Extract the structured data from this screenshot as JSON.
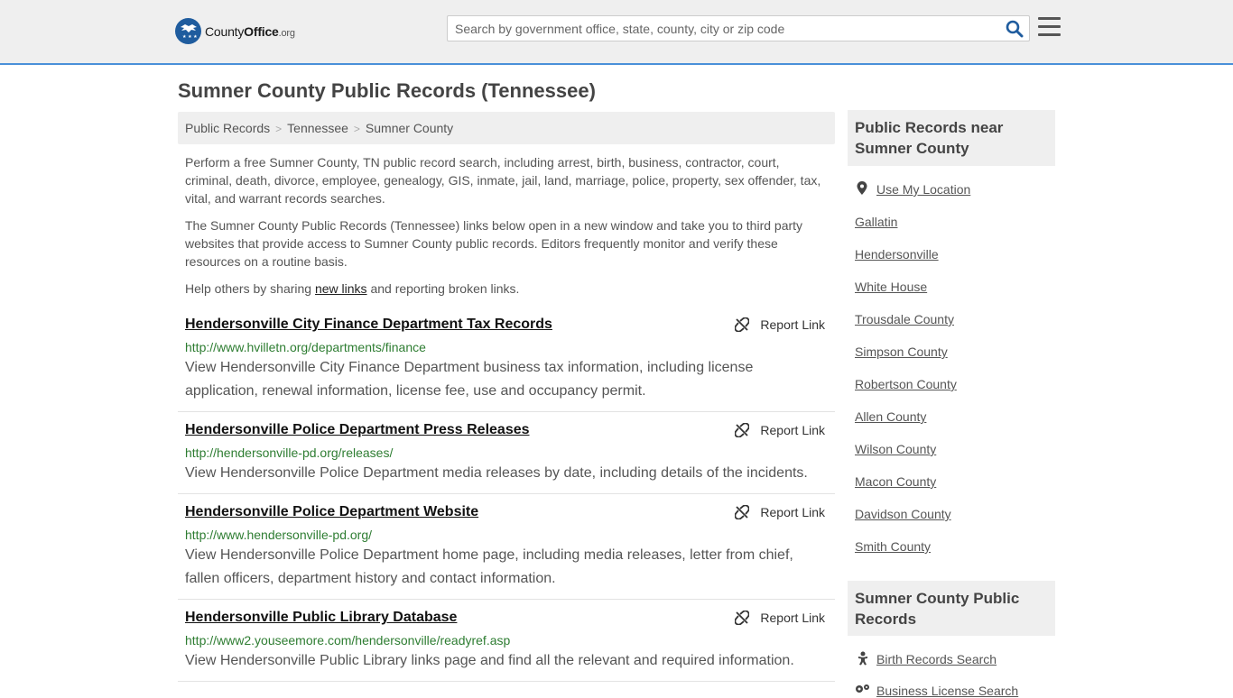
{
  "header": {
    "logo_county": "County",
    "logo_office": "Office",
    "logo_org": ".org",
    "search_placeholder": "Search by government office, state, county, city or zip code"
  },
  "page_title": "Sumner County Public Records (Tennessee)",
  "breadcrumb": [
    "Public Records",
    "Tennessee",
    "Sumner County"
  ],
  "intro": {
    "p1": "Perform a free Sumner County, TN public record search, including arrest, birth, business, contractor, court, criminal, death, divorce, employee, genealogy, GIS, inmate, jail, land, marriage, police, property, sex offender, tax, vital, and warrant records searches.",
    "p2": "The Sumner County Public Records (Tennessee) links below open in a new window and take you to third party websites that provide access to Sumner County public records. Editors frequently monitor and verify these resources on a routine basis.",
    "p3_before": "Help others by sharing ",
    "p3_link": "new links",
    "p3_after": " and reporting broken links."
  },
  "report_label": "Report Link",
  "records": [
    {
      "title": "Hendersonville City Finance Department Tax Records",
      "url": "http://www.hvilletn.org/departments/finance",
      "desc": "View Hendersonville City Finance Department business tax information, including license application, renewal information, license fee, use and occupancy permit."
    },
    {
      "title": "Hendersonville Police Department Press Releases",
      "url": "http://hendersonville-pd.org/releases/",
      "desc": "View Hendersonville Police Department media releases by date, including details of the incidents."
    },
    {
      "title": "Hendersonville Police Department Website",
      "url": "http://www.hendersonville-pd.org/",
      "desc": "View Hendersonville Police Department home page, including media releases, letter from chief, fallen officers, department history and contact information."
    },
    {
      "title": "Hendersonville Public Library Database",
      "url": "http://www2.youseemore.com/hendersonville/readyref.asp",
      "desc": "View Hendersonville Public Library links page and find all the relevant and required information."
    }
  ],
  "sidebar": {
    "near_title": "Public Records near Sumner County",
    "use_location": "Use My Location",
    "nearby": [
      "Gallatin",
      "Hendersonville",
      "White House",
      "Trousdale County",
      "Simpson County",
      "Robertson County",
      "Allen County",
      "Wilson County",
      "Macon County",
      "Davidson County",
      "Smith County"
    ],
    "county_title": "Sumner County Public Records",
    "county_links": [
      "Birth Records Search",
      "Business License Search"
    ]
  }
}
